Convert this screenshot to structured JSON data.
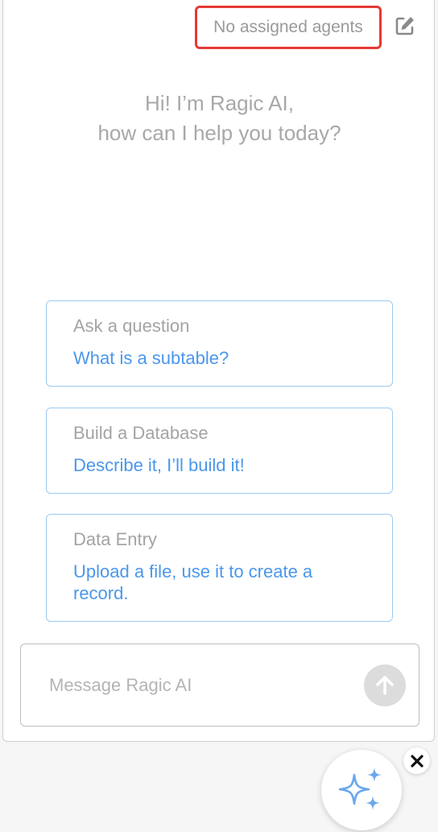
{
  "header": {
    "agents_label": "No assigned agents",
    "edit_icon": "edit-icon"
  },
  "greeting": {
    "line1": "Hi! I’m Ragic AI,",
    "line2": "how can I help you today?"
  },
  "suggestions": [
    {
      "title": "Ask a question",
      "desc": "What is a subtable?"
    },
    {
      "title": "Build a Database",
      "desc": "Describe it, I’ll build it!"
    },
    {
      "title": "Data Entry",
      "desc": "Upload a file, use it to create a record."
    }
  ],
  "composer": {
    "placeholder": "Message Ragic AI",
    "send_icon": "arrow-up-icon"
  },
  "launcher": {
    "icon": "sparkles-icon",
    "close_icon": "close-icon"
  },
  "colors": {
    "highlight": "#e53935",
    "accent": "#4a97ec",
    "card_border": "#9ccaf2"
  }
}
